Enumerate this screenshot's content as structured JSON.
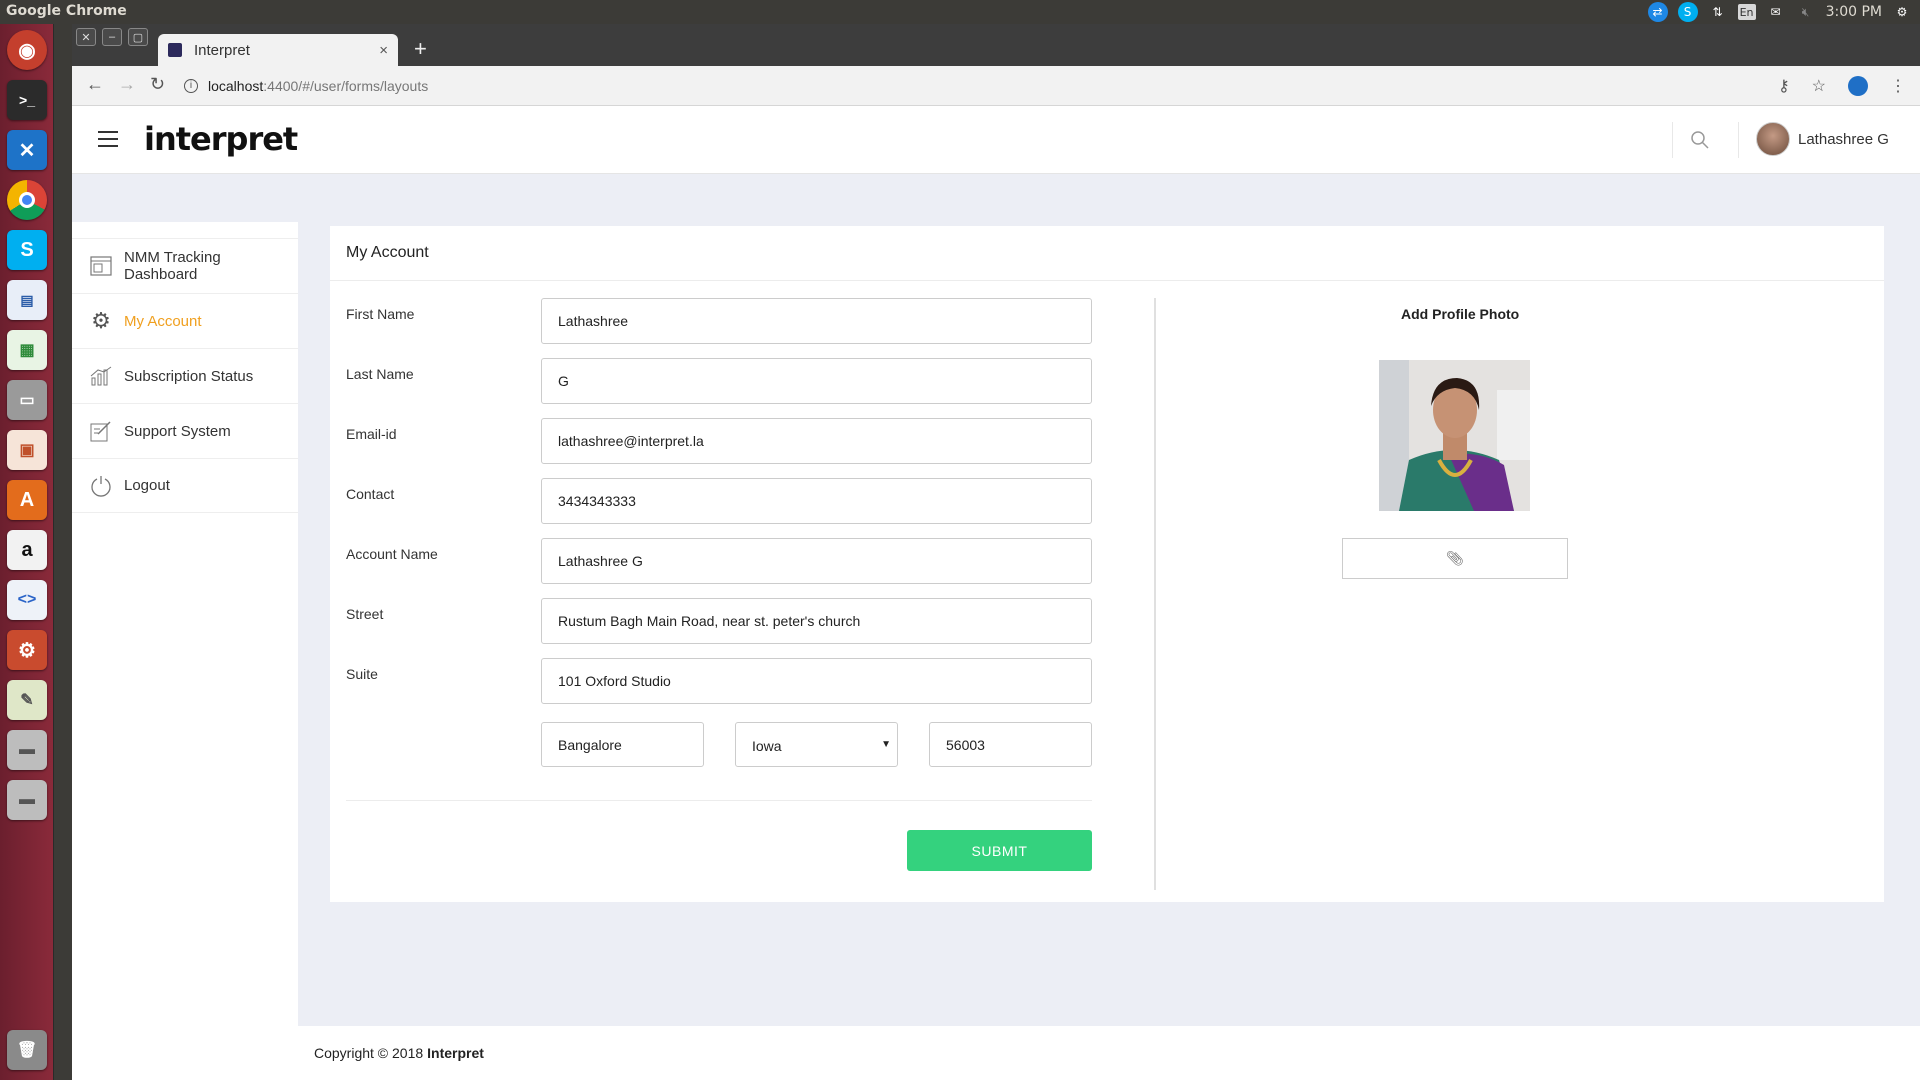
{
  "os": {
    "app_name": "Google Chrome",
    "clock": "3:00 PM",
    "tray_lang": "En"
  },
  "launcher": {
    "apps": [
      "ubuntu-dash-icon",
      "terminal-icon",
      "vscode-icon",
      "chrome-icon",
      "skype-icon",
      "writer-icon",
      "calc-icon",
      "files-icon",
      "impress-icon",
      "software-center-icon",
      "amazon-icon",
      "code-editor-icon",
      "settings-icon",
      "image-viewer-icon",
      "drive-icon",
      "drive-icon",
      "trash-icon"
    ]
  },
  "browser": {
    "tab_title": "Interpret",
    "url_host": "localhost",
    "url_path": ":4400/#/user/forms/layouts",
    "new_tab": "+",
    "tab_close": "×"
  },
  "header": {
    "logo": "interpret",
    "user_name": "Lathashree G"
  },
  "sidebar": {
    "items": [
      {
        "label": "NMM Tracking Dashboard",
        "icon": "dashboard-icon",
        "active": false
      },
      {
        "label": "My Account",
        "icon": "gear-icon",
        "active": true
      },
      {
        "label": "Subscription Status",
        "icon": "bar-chart-icon",
        "active": false
      },
      {
        "label": "Support System",
        "icon": "edit-icon",
        "active": false
      },
      {
        "label": "Logout",
        "icon": "power-icon",
        "active": false
      }
    ]
  },
  "form": {
    "title": "My Account",
    "labels": {
      "first_name": "First Name",
      "last_name": "Last Name",
      "email": "Email-id",
      "contact": "Contact",
      "account_name": "Account Name",
      "street": "Street",
      "suite": "Suite"
    },
    "values": {
      "first_name": "Lathashree",
      "last_name": "G",
      "email": "lathashree@interpret.la",
      "contact": "3434343333",
      "account_name": "Lathashree G",
      "street": "Rustum Bagh Main Road, near st. peter's church",
      "suite": "101 Oxford Studio",
      "city": "Bangalore",
      "state": "Iowa",
      "zip": "56003"
    },
    "submit_label": "SUBMIT",
    "photo_title": "Add Profile Photo"
  },
  "footer": {
    "copyright": "Copyright © 2018",
    "brand": "Interpret"
  },
  "colors": {
    "accent_active": "#f0a020",
    "submit": "#34d27e",
    "page_bg": "#eceef5"
  }
}
